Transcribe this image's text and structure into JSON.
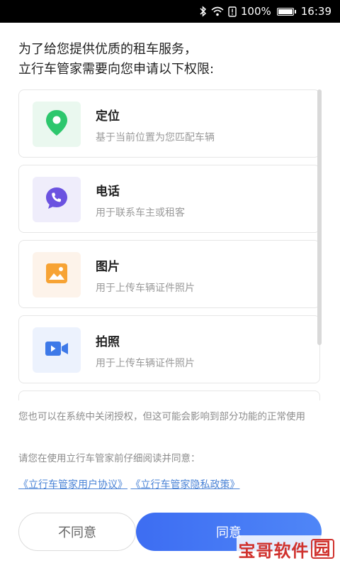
{
  "status_bar": {
    "battery_text": "100%",
    "time": "16:39"
  },
  "intro": {
    "line1": "为了给您提供优质的租车服务，",
    "line2": "立行车管家需要向您申请以下权限:"
  },
  "permissions": [
    {
      "title": "定位",
      "desc": "基于当前位置为您匹配车辆",
      "icon": "location-pin-icon",
      "bg": "#eaf8ef",
      "color": "#2dc76d"
    },
    {
      "title": "电话",
      "desc": "用于联系车主或租客",
      "icon": "phone-icon",
      "bg": "#efedfb",
      "color": "#6b52e0"
    },
    {
      "title": "图片",
      "desc": "用于上传车辆证件照片",
      "icon": "image-icon",
      "bg": "#fdf3ea",
      "color": "#f7a334"
    },
    {
      "title": "拍照",
      "desc": "用于上传车辆证件照片",
      "icon": "video-camera-icon",
      "bg": "#ecf2fd",
      "color": "#3d79e8"
    }
  ],
  "notice": "您也可以在系统中关闭授权，但这可能会影响到部分功能的正常使用",
  "prompt": "请您在使用立行车管家前仔细阅读并同意：",
  "links": {
    "user_agreement": "《立行车管家用户协议》",
    "privacy_policy": "《立行车管家隐私政策》"
  },
  "buttons": {
    "disagree": "不同意",
    "agree": "同意"
  },
  "watermark": {
    "text_main": "宝哥软件",
    "text_boxed": "园"
  },
  "colors": {
    "accent": "#4a7ff5",
    "link": "#4a83d6"
  }
}
